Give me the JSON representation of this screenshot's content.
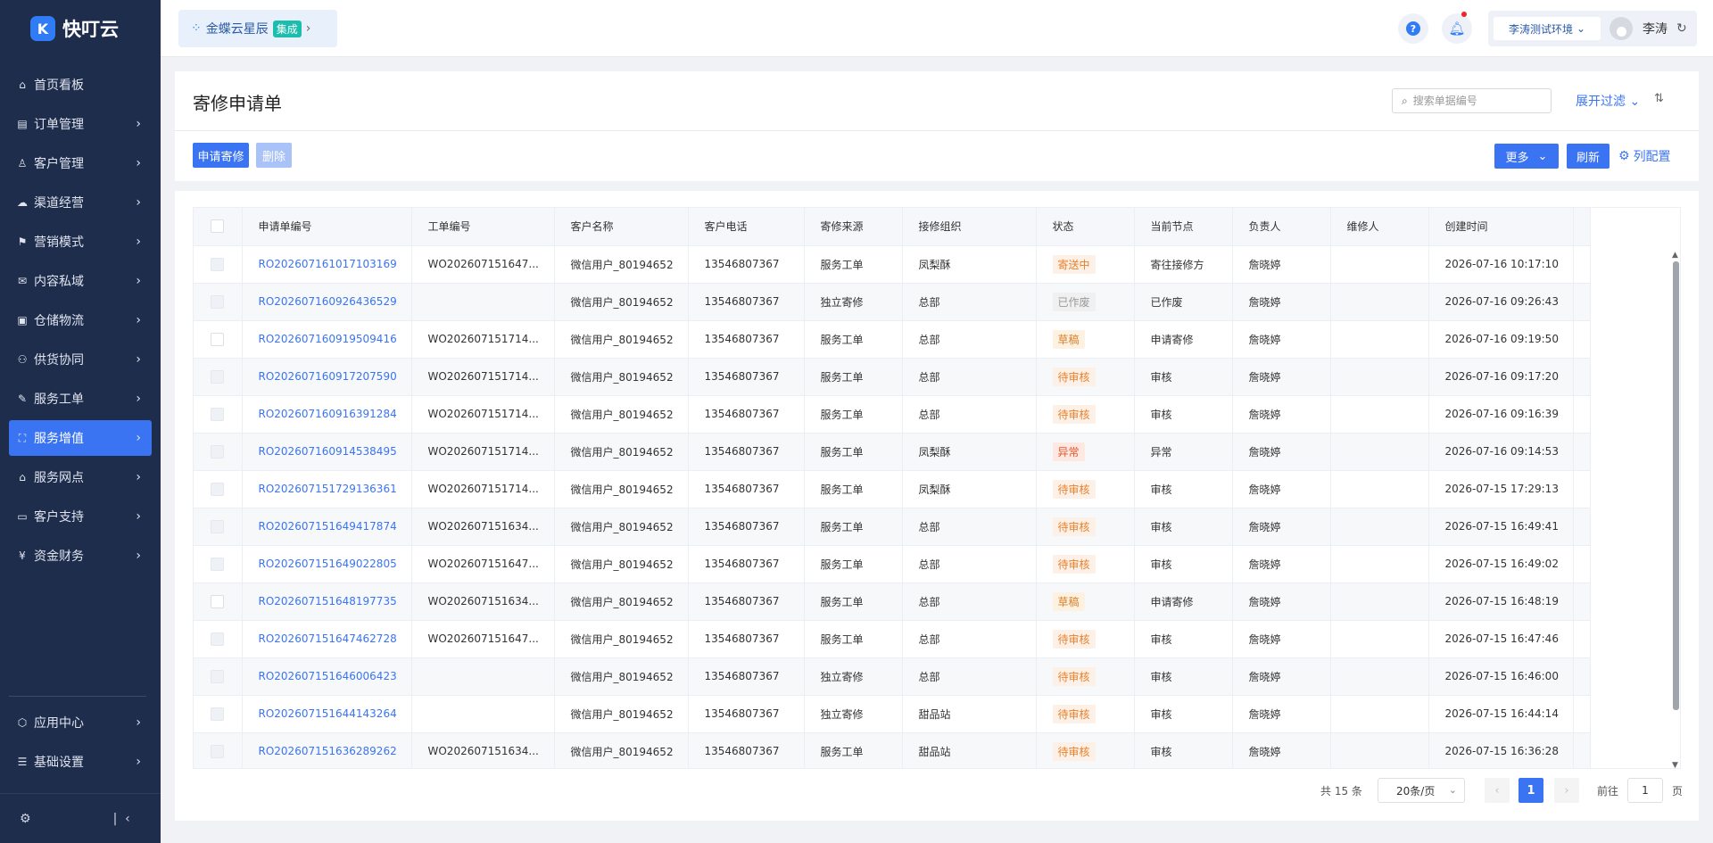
{
  "app": {
    "name": "快叮云",
    "logo_glyph": "K"
  },
  "sidebar": {
    "items": [
      {
        "label": "首页看板",
        "icon": "home-icon",
        "glyph": "⌂",
        "chevron": false,
        "active": false
      },
      {
        "label": "订单管理",
        "icon": "order-icon",
        "glyph": "▤",
        "chevron": true,
        "active": false
      },
      {
        "label": "客户管理",
        "icon": "user-icon",
        "glyph": "♙",
        "chevron": true,
        "active": false
      },
      {
        "label": "渠道经营",
        "icon": "channel-icon",
        "glyph": "☁",
        "chevron": true,
        "active": false
      },
      {
        "label": "营销模式",
        "icon": "marketing-icon",
        "glyph": "⚑",
        "chevron": true,
        "active": false
      },
      {
        "label": "内容私域",
        "icon": "content-icon",
        "glyph": "✉",
        "chevron": true,
        "active": false
      },
      {
        "label": "仓储物流",
        "icon": "warehouse-icon",
        "glyph": "▣",
        "chevron": true,
        "active": false
      },
      {
        "label": "供货协同",
        "icon": "supply-icon",
        "glyph": "⚇",
        "chevron": true,
        "active": false
      },
      {
        "label": "服务工单",
        "icon": "workorder-icon",
        "glyph": "✎",
        "chevron": true,
        "active": false
      },
      {
        "label": "服务增值",
        "icon": "bag-icon",
        "glyph": "⛶",
        "chevron": true,
        "active": true
      },
      {
        "label": "服务网点",
        "icon": "store-icon",
        "glyph": "⌂",
        "chevron": true,
        "active": false
      },
      {
        "label": "客户支持",
        "icon": "support-icon",
        "glyph": "▭",
        "chevron": true,
        "active": false
      },
      {
        "label": "资金财务",
        "icon": "yuan-icon",
        "glyph": "¥",
        "chevron": true,
        "active": false
      }
    ],
    "bottom_items": [
      {
        "label": "应用中心",
        "icon": "cube-icon",
        "glyph": "⬡"
      },
      {
        "label": "基础设置",
        "icon": "settings-list-icon",
        "glyph": "☰"
      }
    ]
  },
  "topbar": {
    "integration_name": "金蝶云星辰",
    "integration_tag": "集成",
    "help_glyph": "?",
    "environment": "李涛测试环境",
    "user_name": "李涛"
  },
  "page": {
    "title": "寄修申请单",
    "search_placeholder": "搜索单据编号",
    "expand_filter": "展开过滤",
    "buttons": {
      "apply": "申请寄修",
      "delete": "删除",
      "more": "更多",
      "refresh": "刷新",
      "column_config": "列配置"
    }
  },
  "colors": {
    "accent": "#3a74f2",
    "sidebar_bg": "#1f2d4d"
  },
  "status_styles": {
    "寄送中": {
      "fg": "#e6822e",
      "bg": "#fdf0e6"
    },
    "已作废": {
      "fg": "#999999",
      "bg": "#f0f0f0"
    },
    "草稿": {
      "fg": "#d9822b",
      "bg": "#fdf1e2"
    },
    "待审核": {
      "fg": "#e6822e",
      "bg": "#fdf0e6"
    },
    "异常": {
      "fg": "#e4572e",
      "bg": "#fde9e2"
    }
  },
  "table": {
    "columns": [
      "申请单编号",
      "工单编号",
      "客户名称",
      "客户电话",
      "寄修来源",
      "接修组织",
      "状态",
      "当前节点",
      "负责人",
      "维修人",
      "创建时间"
    ],
    "rows": [
      {
        "id": "RO202607161017103169",
        "wo": "WO202607151647...",
        "customer": "微信用户_80194652",
        "phone": "13546807367",
        "source": "服务工单",
        "org": "凤梨酥",
        "status": "寄送中",
        "node": "寄往接修方",
        "owner": "詹晓婷",
        "repairer": "",
        "created": "2026-07-16 10:17:10",
        "checkbox_enabled": false
      },
      {
        "id": "RO202607160926436529",
        "wo": "",
        "customer": "微信用户_80194652",
        "phone": "13546807367",
        "source": "独立寄修",
        "org": "总部",
        "status": "已作废",
        "node": "已作废",
        "owner": "詹晓婷",
        "repairer": "",
        "created": "2026-07-16 09:26:43",
        "checkbox_enabled": false
      },
      {
        "id": "RO202607160919509416",
        "wo": "WO202607151714...",
        "customer": "微信用户_80194652",
        "phone": "13546807367",
        "source": "服务工单",
        "org": "总部",
        "status": "草稿",
        "node": "申请寄修",
        "owner": "詹晓婷",
        "repairer": "",
        "created": "2026-07-16 09:19:50",
        "checkbox_enabled": true
      },
      {
        "id": "RO202607160917207590",
        "wo": "WO202607151714...",
        "customer": "微信用户_80194652",
        "phone": "13546807367",
        "source": "服务工单",
        "org": "总部",
        "status": "待审核",
        "node": "审核",
        "owner": "詹晓婷",
        "repairer": "",
        "created": "2026-07-16 09:17:20",
        "checkbox_enabled": false
      },
      {
        "id": "RO202607160916391284",
        "wo": "WO202607151714...",
        "customer": "微信用户_80194652",
        "phone": "13546807367",
        "source": "服务工单",
        "org": "总部",
        "status": "待审核",
        "node": "审核",
        "owner": "詹晓婷",
        "repairer": "",
        "created": "2026-07-16 09:16:39",
        "checkbox_enabled": false
      },
      {
        "id": "RO202607160914538495",
        "wo": "WO202607151714...",
        "customer": "微信用户_80194652",
        "phone": "13546807367",
        "source": "服务工单",
        "org": "凤梨酥",
        "status": "异常",
        "node": "异常",
        "owner": "詹晓婷",
        "repairer": "",
        "created": "2026-07-16 09:14:53",
        "checkbox_enabled": false
      },
      {
        "id": "RO202607151729136361",
        "wo": "WO202607151714...",
        "customer": "微信用户_80194652",
        "phone": "13546807367",
        "source": "服务工单",
        "org": "凤梨酥",
        "status": "待审核",
        "node": "审核",
        "owner": "詹晓婷",
        "repairer": "",
        "created": "2026-07-15 17:29:13",
        "checkbox_enabled": false
      },
      {
        "id": "RO202607151649417874",
        "wo": "WO202607151634...",
        "customer": "微信用户_80194652",
        "phone": "13546807367",
        "source": "服务工单",
        "org": "总部",
        "status": "待审核",
        "node": "审核",
        "owner": "詹晓婷",
        "repairer": "",
        "created": "2026-07-15 16:49:41",
        "checkbox_enabled": false
      },
      {
        "id": "RO202607151649022805",
        "wo": "WO202607151647...",
        "customer": "微信用户_80194652",
        "phone": "13546807367",
        "source": "服务工单",
        "org": "总部",
        "status": "待审核",
        "node": "审核",
        "owner": "詹晓婷",
        "repairer": "",
        "created": "2026-07-15 16:49:02",
        "checkbox_enabled": false
      },
      {
        "id": "RO202607151648197735",
        "wo": "WO202607151634...",
        "customer": "微信用户_80194652",
        "phone": "13546807367",
        "source": "服务工单",
        "org": "总部",
        "status": "草稿",
        "node": "申请寄修",
        "owner": "詹晓婷",
        "repairer": "",
        "created": "2026-07-15 16:48:19",
        "checkbox_enabled": true
      },
      {
        "id": "RO202607151647462728",
        "wo": "WO202607151647...",
        "customer": "微信用户_80194652",
        "phone": "13546807367",
        "source": "服务工单",
        "org": "总部",
        "status": "待审核",
        "node": "审核",
        "owner": "詹晓婷",
        "repairer": "",
        "created": "2026-07-15 16:47:46",
        "checkbox_enabled": false
      },
      {
        "id": "RO202607151646006423",
        "wo": "",
        "customer": "微信用户_80194652",
        "phone": "13546807367",
        "source": "独立寄修",
        "org": "总部",
        "status": "待审核",
        "node": "审核",
        "owner": "詹晓婷",
        "repairer": "",
        "created": "2026-07-15 16:46:00",
        "checkbox_enabled": false
      },
      {
        "id": "RO202607151644143264",
        "wo": "",
        "customer": "微信用户_80194652",
        "phone": "13546807367",
        "source": "独立寄修",
        "org": "甜品站",
        "status": "待审核",
        "node": "审核",
        "owner": "詹晓婷",
        "repairer": "",
        "created": "2026-07-15 16:44:14",
        "checkbox_enabled": false
      },
      {
        "id": "RO202607151636289262",
        "wo": "WO202607151634...",
        "customer": "微信用户_80194652",
        "phone": "13546807367",
        "source": "服务工单",
        "org": "甜品站",
        "status": "待审核",
        "node": "审核",
        "owner": "詹晓婷",
        "repairer": "",
        "created": "2026-07-15 16:36:28",
        "checkbox_enabled": false
      }
    ]
  },
  "pagination": {
    "total_text": "共 15 条",
    "page_size": "20条/页",
    "current_page": "1",
    "goto_label": "前往",
    "goto_value": "1",
    "page_suffix": "页"
  }
}
